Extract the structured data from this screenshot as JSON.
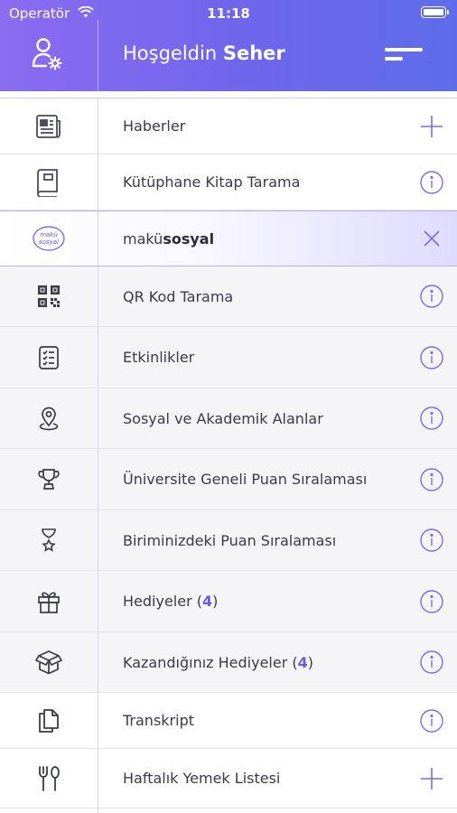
{
  "status_bar": {
    "carrier": "Operatör",
    "time": "11:18"
  },
  "header": {
    "greeting": "Hoşgeldin",
    "user_name": "Seher",
    "profile_icon": "user-settings-icon",
    "menu_icon": "menu-icon"
  },
  "colors": {
    "accent": "#6a5ae0",
    "header_start": "#8a6cf0",
    "header_end": "#5d6de9"
  },
  "menu": [
    {
      "id": "haberler",
      "label": "Haberler",
      "icon": "newspaper-icon",
      "action": "plus",
      "style": "white"
    },
    {
      "id": "kutuphane",
      "label": "Kütüphane Kitap Tarama",
      "icon": "book-icon",
      "action": "info",
      "style": "white"
    },
    {
      "id": "makusosyal",
      "label_a": "makü",
      "label_b": "sosyal",
      "icon": "makusosyal-logo-icon",
      "logo_text_1": "makü",
      "logo_text_2": "sosyal",
      "action": "close",
      "style": "active"
    },
    {
      "id": "qr",
      "label": "QR Kod Tarama",
      "icon": "qr-code-icon",
      "action": "info",
      "style": "gray"
    },
    {
      "id": "etkinlikler",
      "label": "Etkinlikler",
      "icon": "checklist-icon",
      "action": "info",
      "style": "gray"
    },
    {
      "id": "alanlar",
      "label": "Sosyal ve Akademik Alanlar",
      "icon": "location-pin-icon",
      "action": "info",
      "style": "gray"
    },
    {
      "id": "universite",
      "label": "Üniversite Geneli Puan Sıralaması",
      "icon": "trophy-icon",
      "action": "info",
      "style": "gray"
    },
    {
      "id": "birim",
      "label": "Biriminizdeki Puan Sıralaması",
      "icon": "star-glass-icon",
      "action": "info",
      "style": "gray"
    },
    {
      "id": "hediyeler",
      "label": "Hediyeler (",
      "count": "4",
      "label_end": ")",
      "icon": "gift-icon",
      "action": "info",
      "style": "gray"
    },
    {
      "id": "kazandiginiz",
      "label": "Kazandığınız Hediyeler (",
      "count": "4",
      "label_end": ")",
      "icon": "open-box-icon",
      "action": "info",
      "style": "gray"
    },
    {
      "id": "transkript",
      "label": "Transkript",
      "icon": "documents-icon",
      "action": "info",
      "style": "white"
    },
    {
      "id": "yemek",
      "label": "Haftalık Yemek Listesi",
      "icon": "fork-spoon-icon",
      "action": "plus",
      "style": "white"
    }
  ]
}
